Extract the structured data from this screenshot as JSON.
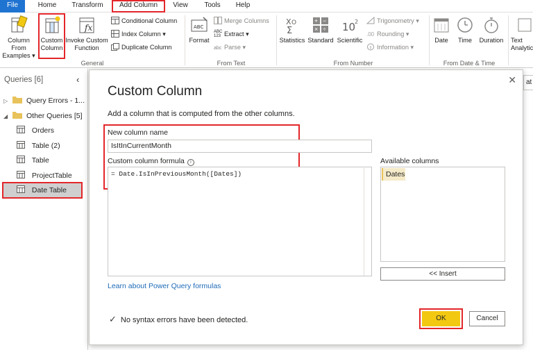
{
  "menu": {
    "file": "File",
    "home": "Home",
    "transform": "Transform",
    "add_column": "Add Column",
    "view": "View",
    "tools": "Tools",
    "help": "Help"
  },
  "ribbon": {
    "column_from_examples": [
      "Column From",
      "Examples ▾"
    ],
    "custom_column": [
      "Custom",
      "Column"
    ],
    "invoke_custom_function": [
      "Invoke Custom",
      "Function"
    ],
    "conditional_column": "Conditional Column",
    "index_column": "Index Column ▾",
    "duplicate_column": "Duplicate Column",
    "general_label": "General",
    "format": "Format",
    "merge_columns": "Merge Columns",
    "extract": "Extract ▾",
    "parse": "Parse ▾",
    "from_text_label": "From Text",
    "statistics": "Statistics",
    "standard": "Standard",
    "scientific": "Scientific",
    "trigonometry": "Trigonometry ▾",
    "rounding": "Rounding ▾",
    "information": "Information ▾",
    "from_number_label": "From Number",
    "date": "Date",
    "time": "Time",
    "duration": "Duration",
    "from_date_time_label": "From Date & Time",
    "text_analytics": [
      "Text",
      "Analytics"
    ],
    "abc_icon": "ABC",
    "abc123_icon": [
      "ABC",
      "123"
    ],
    "abc_parse_icon": "abc"
  },
  "queries": {
    "title": "Queries [6]",
    "collapse_icon": "‹",
    "items": [
      {
        "label": "Query Errors - 1...",
        "type": "folder",
        "expanded": false
      },
      {
        "label": "Other Queries [5]",
        "type": "folder",
        "expanded": true
      },
      {
        "label": "Orders",
        "type": "table"
      },
      {
        "label": "Table (2)",
        "type": "table"
      },
      {
        "label": "Table",
        "type": "table"
      },
      {
        "label": "ProjectTable",
        "type": "table"
      },
      {
        "label": "Date Table",
        "type": "table",
        "selected": true
      }
    ]
  },
  "background": {
    "formula_fragment": "at"
  },
  "dialog": {
    "title": "Custom Column",
    "subtitle": "Add a column that is computed from the other columns.",
    "new_column_label": "New column name",
    "new_column_value": "IsItInCurrentMonth",
    "formula_label": "Custom column formula",
    "info_icon": "i",
    "formula_value": "= Date.IsInPreviousMonth([Dates])",
    "available_label": "Available columns",
    "available_items": [
      "Dates"
    ],
    "insert_button": "<< Insert",
    "learn_link": "Learn about Power Query formulas",
    "status": "No syntax errors have been detected.",
    "ok_button": "OK",
    "cancel_button": "Cancel",
    "close_icon": "✕",
    "check_icon": "✓"
  },
  "colors": {
    "accent_file": "#1f73d1",
    "highlight_red": "#e3262a",
    "ok_yellow": "#f2c811",
    "link_blue": "#1e6bb8"
  }
}
